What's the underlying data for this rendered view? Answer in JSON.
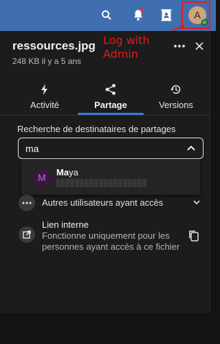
{
  "topbar": {
    "icons": [
      "search-icon",
      "bell-icon",
      "contacts-icon"
    ],
    "avatar_initial": "A",
    "colors": {
      "bar": "#3f6fb0",
      "avatar": "#cfa57a",
      "status": "#4caf50",
      "highlight": "#e51c1c"
    }
  },
  "file": {
    "name": "ressources.jpg",
    "meta": "248 KB il y a 5 ans"
  },
  "annotation": {
    "line1": "Log with",
    "line2": "Admin",
    "color": "#e11b1b"
  },
  "tabs": [
    {
      "label": "Activité",
      "icon": "flash-icon",
      "active": false
    },
    {
      "label": "Partage",
      "icon": "share-icon",
      "active": true
    },
    {
      "label": "Versions",
      "icon": "history-icon",
      "active": false
    }
  ],
  "sharing": {
    "search_label": "Recherche de destinataires de partages",
    "search_value": "ma",
    "suggestion": {
      "initial": "M",
      "name_match": "Ma",
      "name_rest": "ya"
    },
    "other_users_label": "Autres utilisateurs ayant accès",
    "internal_link": {
      "title": "Lien interne",
      "description": "Fonctionne uniquement pour les personnes ayant accès à ce fichier"
    }
  },
  "accent_color": "#3b7ad8"
}
